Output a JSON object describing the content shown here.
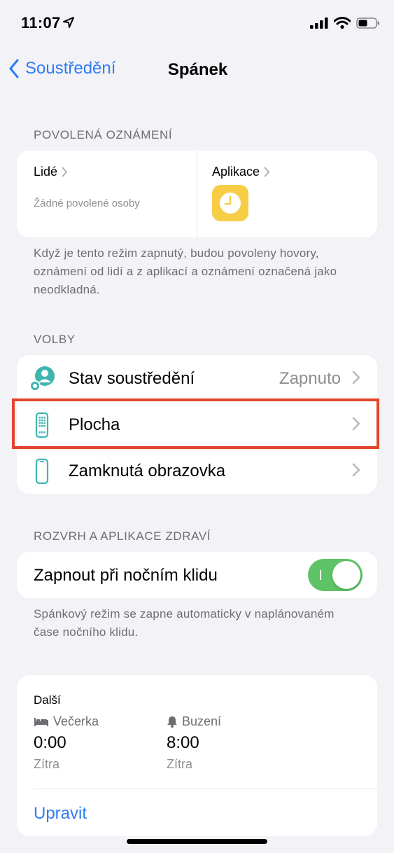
{
  "status_bar": {
    "time": "11:07",
    "icons": [
      "location-arrow-icon",
      "cellular-signal-icon",
      "wifi-icon",
      "battery-icon"
    ]
  },
  "nav": {
    "back_label": "Soustředění",
    "title": "Spánek"
  },
  "allowed": {
    "header": "POVOLENÁ OZNÁMENÍ",
    "people_label": "Lidé",
    "people_sub": "Žádné povolené osoby",
    "apps_label": "Aplikace",
    "app_icon": "clock-icon",
    "footnote": "Když je tento režim zapnutý, budou povoleny hovory, oznámení od lidí a z aplikací a oznámení označená jako neodkladná."
  },
  "options": {
    "header": "VOLBY",
    "items": [
      {
        "label": "Stav soustředění",
        "value": "Zapnuto",
        "icon": "focus-status-icon"
      },
      {
        "label": "Plocha",
        "value": "",
        "icon": "home-screen-icon"
      },
      {
        "label": "Zamknutá obrazovka",
        "value": "",
        "icon": "lock-screen-icon"
      }
    ]
  },
  "schedule": {
    "header": "ROZVRH A APLIKACE ZDRAVÍ",
    "toggle_label": "Zapnout při nočním klidu",
    "toggle_on": true,
    "footnote": "Spánkový režim se zapne automaticky v naplánovaném čase nočního klidu."
  },
  "next": {
    "title": "Další",
    "bedtime": {
      "label": "Večerka",
      "time": "0:00",
      "day": "Zítra",
      "icon": "bed-icon"
    },
    "wake": {
      "label": "Buzení",
      "time": "8:00",
      "day": "Zítra",
      "icon": "bell-icon"
    },
    "edit_label": "Upravit"
  },
  "colors": {
    "accent": "#2f7cf6",
    "toggle_on": "#5ec366",
    "icon_teal": "#3fb5b0",
    "highlight": "#e2452b",
    "app_icon_bg": "#f7cd45",
    "background": "#f2f2f7"
  }
}
